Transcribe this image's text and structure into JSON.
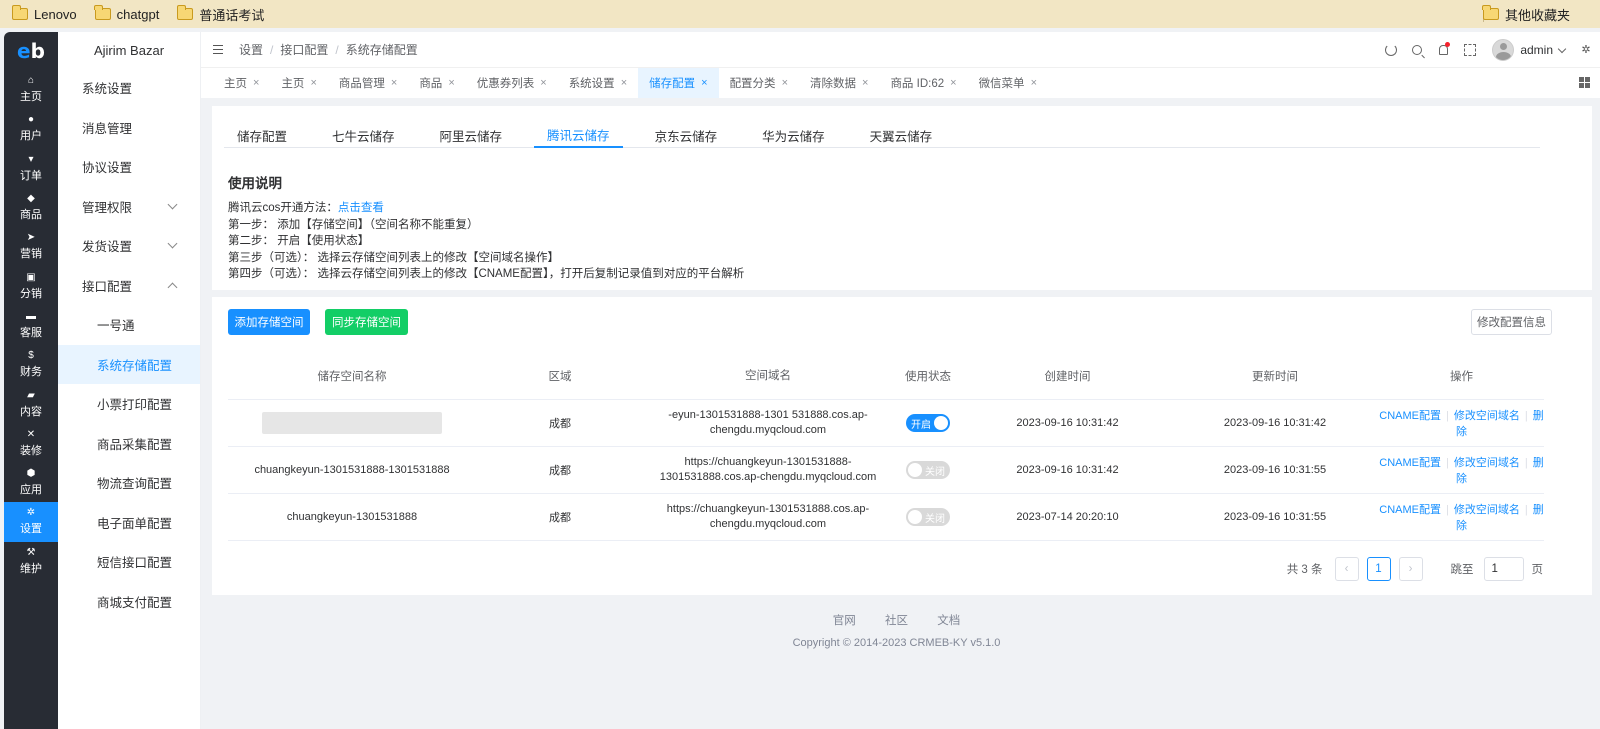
{
  "bookmarks": {
    "items": [
      "Lenovo",
      "chatgpt",
      "普通话考试"
    ],
    "other": "其他收藏夹"
  },
  "rail": {
    "logo": "eb",
    "items": [
      {
        "label": "主页",
        "icon": "home-icon",
        "glyph": "⌂"
      },
      {
        "label": "用户",
        "icon": "user-icon",
        "glyph": "●"
      },
      {
        "label": "订单",
        "icon": "cart-icon",
        "glyph": "▾"
      },
      {
        "label": "商品",
        "icon": "shop-icon",
        "glyph": "◆"
      },
      {
        "label": "营销",
        "icon": "send-icon",
        "glyph": "➤"
      },
      {
        "label": "分销",
        "icon": "distribution-icon",
        "glyph": "▣"
      },
      {
        "label": "客服",
        "icon": "chat-icon",
        "glyph": "▬"
      },
      {
        "label": "财务",
        "icon": "dollar-icon",
        "glyph": "$"
      },
      {
        "label": "内容",
        "icon": "book-icon",
        "glyph": "▰"
      },
      {
        "label": "装修",
        "icon": "tools-icon",
        "glyph": "✕"
      },
      {
        "label": "应用",
        "icon": "app-icon",
        "glyph": "⬢"
      },
      {
        "label": "设置",
        "icon": "gear-icon",
        "glyph": "✲"
      },
      {
        "label": "维护",
        "icon": "hammer-icon",
        "glyph": "⚒"
      }
    ]
  },
  "submenu": {
    "brand": "Ajirim Bazar",
    "items": [
      {
        "label": "系统设置"
      },
      {
        "label": "消息管理"
      },
      {
        "label": "协议设置"
      },
      {
        "label": "管理权限"
      },
      {
        "label": "发货设置"
      },
      {
        "label": "接口配置"
      },
      {
        "label": "一号通"
      },
      {
        "label": "系统存储配置"
      },
      {
        "label": "小票打印配置"
      },
      {
        "label": "商品采集配置"
      },
      {
        "label": "物流查询配置"
      },
      {
        "label": "电子面单配置"
      },
      {
        "label": "短信接口配置"
      },
      {
        "label": "商城支付配置"
      }
    ]
  },
  "header": {
    "breadcrumb": [
      "设置",
      "接口配置",
      "系统存储配置"
    ],
    "user": "admin"
  },
  "tabs": [
    "主页",
    "主页",
    "商品管理",
    "商品",
    "优惠券列表",
    "系统设置",
    "储存配置",
    "配置分类",
    "清除数据",
    "商品 ID:62",
    "微信菜单"
  ],
  "subtabs": [
    "储存配置",
    "七牛云储存",
    "阿里云储存",
    "腾讯云储存",
    "京东云储存",
    "华为云储存",
    "天翼云储存"
  ],
  "usage": {
    "title": "使用说明",
    "intro": "腾讯云cos开通方法：",
    "intro_link": "点击查看",
    "steps": [
      "第一步： 添加【存储空间】（空间名称不能重复）",
      "第二步： 开启【使用状态】",
      "第三步（可选）： 选择云存储空间列表上的修改【空间域名操作】",
      "第四步（可选）： 选择云存储空间列表上的修改【CNAME配置】，打开后复制记录值到对应的平台解析"
    ]
  },
  "buttons": {
    "add": "添加存储空间",
    "sync": "同步存储空间",
    "edit_config": "修改配置信息"
  },
  "table": {
    "headers": [
      "储存空间名称",
      "区域",
      "空间域名",
      "使用状态",
      "创建时间",
      "更新时间",
      "操作"
    ],
    "ops": [
      "CNAME配置",
      "修改空间域名",
      "删除"
    ],
    "rows": [
      {
        "name": "",
        "region": "成都",
        "domain": "-eyun-1301531888-1301 531888.cos.ap-chengdu.myqcloud.com",
        "status_label": "开启",
        "status_on": true,
        "created": "2023-09-16 10:31:42",
        "updated": "2023-09-16 10:31:42"
      },
      {
        "name": "chuangkeyun-1301531888-1301531888",
        "region": "成都",
        "domain": "https://chuangkeyun-1301531888-1301531888.cos.ap-chengdu.myqcloud.com",
        "status_label": "关闭",
        "status_on": false,
        "created": "2023-09-16 10:31:42",
        "updated": "2023-09-16 10:31:55"
      },
      {
        "name": "chuangkeyun-1301531888",
        "region": "成都",
        "domain": "https://chuangkeyun-1301531888.cos.ap-chengdu.myqcloud.com",
        "status_label": "关闭",
        "status_on": false,
        "created": "2023-07-14 20:20:10",
        "updated": "2023-09-16 10:31:55"
      }
    ]
  },
  "pagination": {
    "total": "共 3 条",
    "current": "1",
    "jump_label": "跳至",
    "jump_value": "1",
    "page_unit": "页",
    "prev": "‹",
    "next": "›"
  },
  "footer": {
    "links": [
      "官网",
      "社区",
      "文档"
    ],
    "copyright": "Copyright © 2014-2023 CRMEB-KY v5.1.0"
  },
  "colors": {
    "primary": "#1890ff",
    "success": "#13ce66",
    "rail": "#282c34"
  }
}
